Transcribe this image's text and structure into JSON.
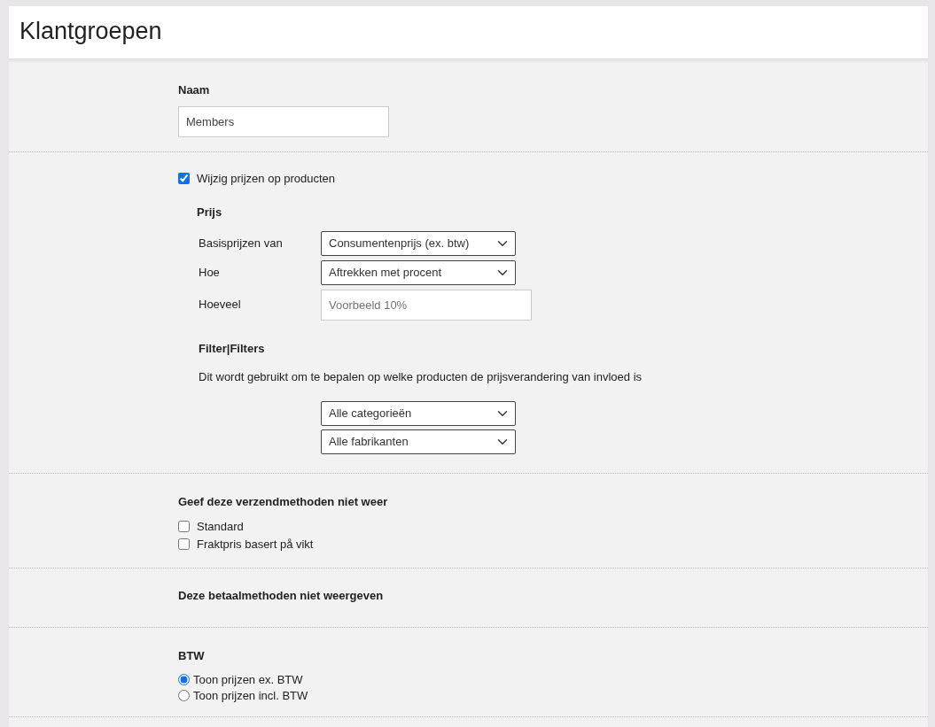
{
  "page_title": "Klantgroepen",
  "name_field": {
    "label": "Naam",
    "value": "Members"
  },
  "change_prices": {
    "label": "Wijzig prijzen op producten",
    "checked": true
  },
  "price": {
    "heading": "Prijs",
    "rows": [
      {
        "kind": "select",
        "label": "Basisprijzen van",
        "value": "Consumentenprijs (ex. btw)"
      },
      {
        "kind": "select",
        "label": "Hoe",
        "value": "Aftrekken met procent"
      },
      {
        "kind": "input",
        "label": "Hoeveel",
        "placeholder": "Voorbeeld 10%"
      }
    ]
  },
  "filters": {
    "heading": "Filter|Filters",
    "description": "Dit wordt gebruikt om te bepalen op welke producten de prijsverandering van invloed is",
    "selects": [
      "Alle categorieën",
      "Alle fabrikanten"
    ]
  },
  "shipping": {
    "heading": "Geef deze verzendmethoden niet weer",
    "options": [
      {
        "label": "Standard",
        "checked": false
      },
      {
        "label": "Fraktpris basert på vikt",
        "checked": false
      }
    ]
  },
  "payment": {
    "heading": "Deze betaalmethoden niet weergeven"
  },
  "vat": {
    "heading": "BTW",
    "options": [
      {
        "label": "Toon prijzen ex. BTW",
        "selected": true
      },
      {
        "label": "Toon prijzen incl. BTW",
        "selected": false
      }
    ]
  }
}
